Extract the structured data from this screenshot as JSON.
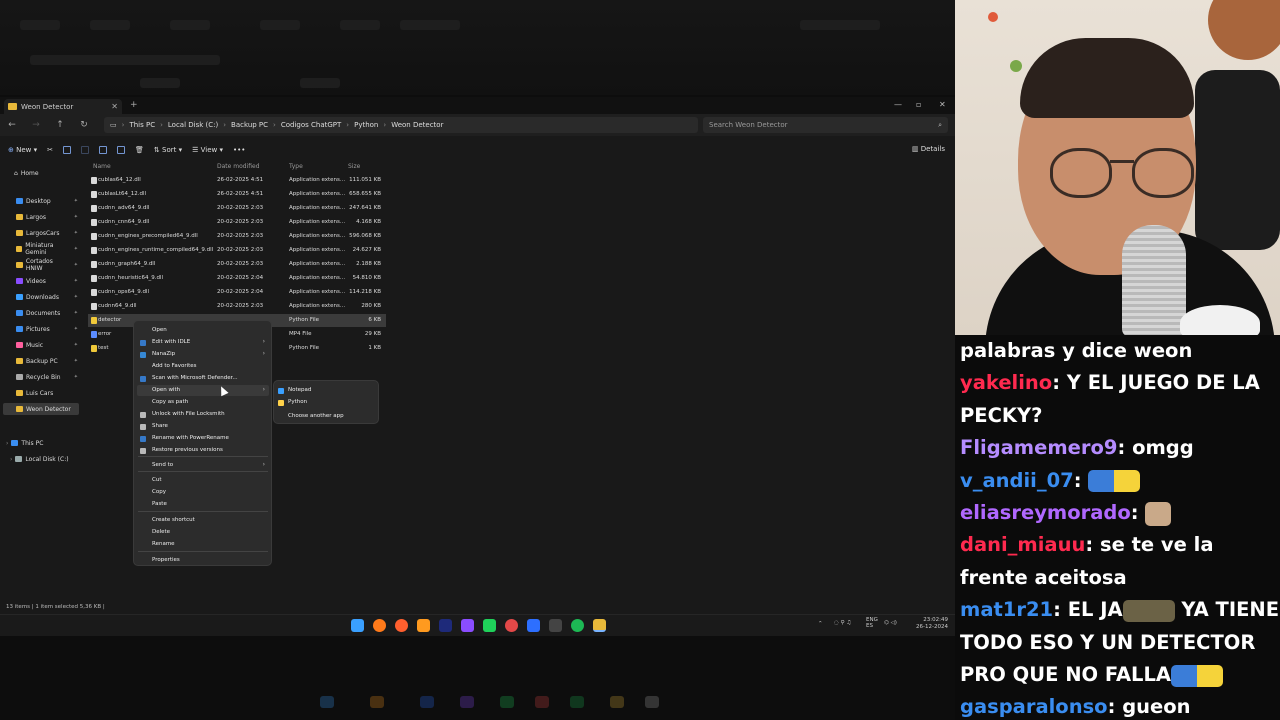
{
  "colors": {
    "folder": "#e8b93a",
    "accent": "#8ab4ff",
    "chat_bg": "#0b0b0b"
  },
  "explorer": {
    "tab_title": "Weon Detector",
    "breadcrumbs": [
      "This PC",
      "Local Disk (C:)",
      "Backup PC",
      "Codigos ChatGPT",
      "Python",
      "Weon Detector"
    ],
    "search_placeholder": "Search Weon Detector",
    "toolbar": {
      "new": "New",
      "sort": "Sort",
      "view": "View",
      "more": "•••",
      "details": "Details"
    },
    "nav": {
      "home": "Home",
      "quick": [
        "Desktop",
        "Largos",
        "LargosCars",
        "Miniatura Gemini",
        "Cortados HNIW",
        "Videos",
        "Downloads",
        "Documents",
        "Pictures",
        "Music",
        "Backup PC",
        "Recycle Bin",
        "Luis Cars",
        "Weon Detector"
      ],
      "this_pc": "This PC",
      "local_disk": "Local Disk (C:)"
    },
    "columns": {
      "name": "Name",
      "date": "Date modified",
      "type": "Type",
      "size": "Size"
    },
    "files": [
      {
        "name": "cublas64_12.dll",
        "date": "26-02-2025 4:51",
        "type": "Application extens...",
        "size": "111.051 KB"
      },
      {
        "name": "cublasLt64_12.dll",
        "date": "26-02-2025 4:51",
        "type": "Application extens...",
        "size": "658.655 KB"
      },
      {
        "name": "cudnn_adv64_9.dll",
        "date": "20-02-2025 2:03",
        "type": "Application extens...",
        "size": "247.641 KB"
      },
      {
        "name": "cudnn_cnn64_9.dll",
        "date": "20-02-2025 2:03",
        "type": "Application extens...",
        "size": "4.168 KB"
      },
      {
        "name": "cudnn_engines_precompiled64_9.dll",
        "date": "20-02-2025 2:03",
        "type": "Application extens...",
        "size": "596.068 KB"
      },
      {
        "name": "cudnn_engines_runtime_compiled64_9.dll",
        "date": "20-02-2025 2:03",
        "type": "Application extens...",
        "size": "24.627 KB"
      },
      {
        "name": "cudnn_graph64_9.dll",
        "date": "20-02-2025 2:03",
        "type": "Application extens...",
        "size": "2.188 KB"
      },
      {
        "name": "cudnn_heuristic64_9.dll",
        "date": "20-02-2025 2:04",
        "type": "Application extens...",
        "size": "54.810 KB"
      },
      {
        "name": "cudnn_ops64_9.dll",
        "date": "20-02-2025 2:04",
        "type": "Application extens...",
        "size": "114.218 KB"
      },
      {
        "name": "cudnn64_9.dll",
        "date": "20-02-2025 2:03",
        "type": "Application extens...",
        "size": "280 KB"
      },
      {
        "name": "detector",
        "date": "",
        "type": "Python File",
        "size": "6 KB"
      },
      {
        "name": "error",
        "date": "",
        "type": "MP4 File",
        "size": "29 KB"
      },
      {
        "name": "test",
        "date": "",
        "type": "Python File",
        "size": "1 KB"
      }
    ],
    "context_menu": [
      "Open",
      "Edit with IDLE",
      "NanaZip",
      "Add to Favorites",
      "Scan with Microsoft Defender...",
      "Open with",
      "Copy as path",
      "Unlock with File Locksmith",
      "Share",
      "Rename with PowerRename",
      "Restore previous versions",
      "Send to",
      "Cut",
      "Copy",
      "Paste",
      "Create shortcut",
      "Delete",
      "Rename",
      "Properties"
    ],
    "open_with_menu": [
      "Notepad",
      "Python",
      "Choose another app"
    ],
    "status": "13 items  |  1 item selected  5,36 KB  |"
  },
  "taskbar": {
    "lang": "ENG\nES",
    "time": "23:02:49",
    "date": "26-12-2024"
  },
  "chat": [
    {
      "user": "",
      "color": "#ffffff",
      "text": "palabras y dice weon",
      "emotes": []
    },
    {
      "user": "yakelino",
      "color": "#ff2a4f",
      "text": "Y EL JUEGO DE LA PECKY?",
      "emotes": []
    },
    {
      "user": "Fligamemero9",
      "color": "#b58cff",
      "text": "omgg",
      "emotes": []
    },
    {
      "user": "v_andii_07",
      "color": "#3a8df0",
      "text": "",
      "emotes": [
        "minion"
      ]
    },
    {
      "user": "eliasreymorado",
      "color": "#b068ff",
      "text": "",
      "emotes": [
        "cat"
      ]
    },
    {
      "user": "dani_miauu",
      "color": "#ff2a4f",
      "text": "se te ve la frente aceitosa",
      "emotes": []
    },
    {
      "user": "mat1r21",
      "color": "#3a8df0",
      "text": "EL JA",
      "text2": "YA TIENE TODO ESO Y UN DETECTOR PRO QUE NO FALLA",
      "emotes": [
        "face",
        "minion"
      ]
    },
    {
      "user": "gasparalonso",
      "color": "#3a8df0",
      "text": "gueon",
      "emotes": []
    }
  ]
}
